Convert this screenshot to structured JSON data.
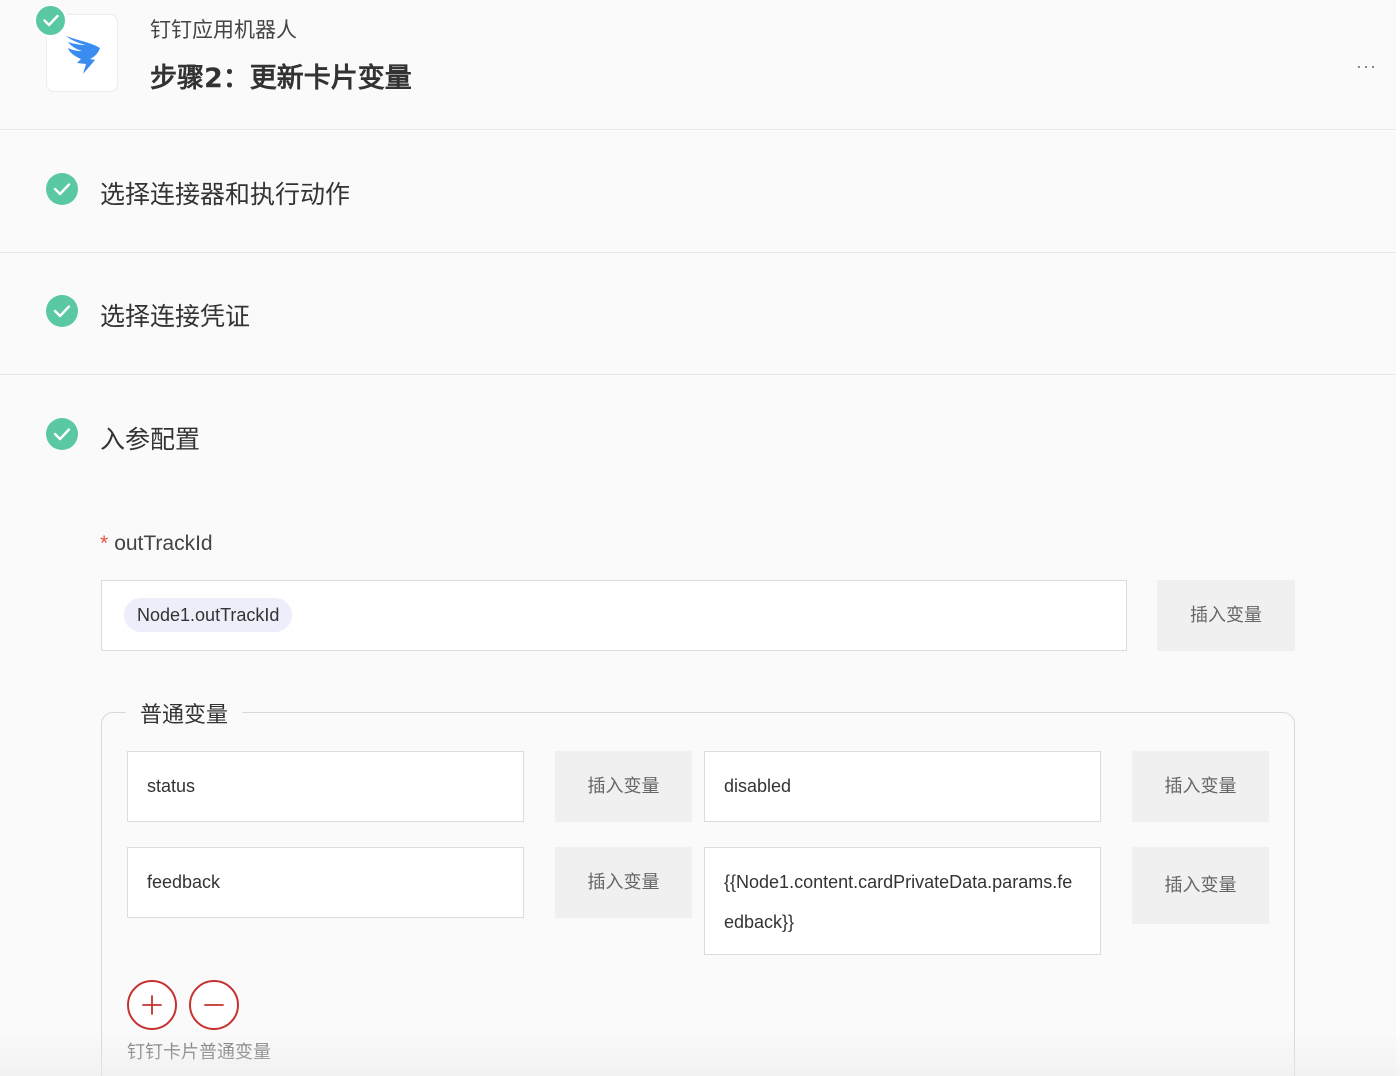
{
  "header": {
    "app_name": "钉钉应用机器人",
    "step_title": "步骤2：更新卡片变量",
    "more_label": "···",
    "app_icon": "dingtalk-logo-icon",
    "status_icon": "check-icon",
    "brand_color": "#3b8cf0"
  },
  "sections": [
    {
      "title": "选择连接器和执行动作",
      "status_icon": "check-icon"
    },
    {
      "title": "选择连接凭证",
      "status_icon": "check-icon"
    },
    {
      "title": "入参配置",
      "status_icon": "check-icon"
    }
  ],
  "params": {
    "out_track_id": {
      "required_mark": "*",
      "label": "outTrackId",
      "value_chip": "Node1.outTrackId",
      "insert_label": "插入变量"
    },
    "normal_vars": {
      "legend": "普通变量",
      "rows": [
        {
          "key": "status",
          "key_insert": "插入变量",
          "value": "disabled",
          "value_insert": "插入变量"
        },
        {
          "key": "feedback",
          "key_insert": "插入变量",
          "value": "{{Node1.content.cardPrivateData.params.feedback}}",
          "value_insert": "插入变量"
        }
      ],
      "add_icon": "plus-icon",
      "remove_icon": "minus-icon",
      "helper_text": "钉钉卡片普通变量"
    }
  },
  "colors": {
    "success": "#5ac8a3",
    "danger": "#c5322f",
    "required": "#e0553b",
    "chip_bg": "#eeeefa"
  }
}
